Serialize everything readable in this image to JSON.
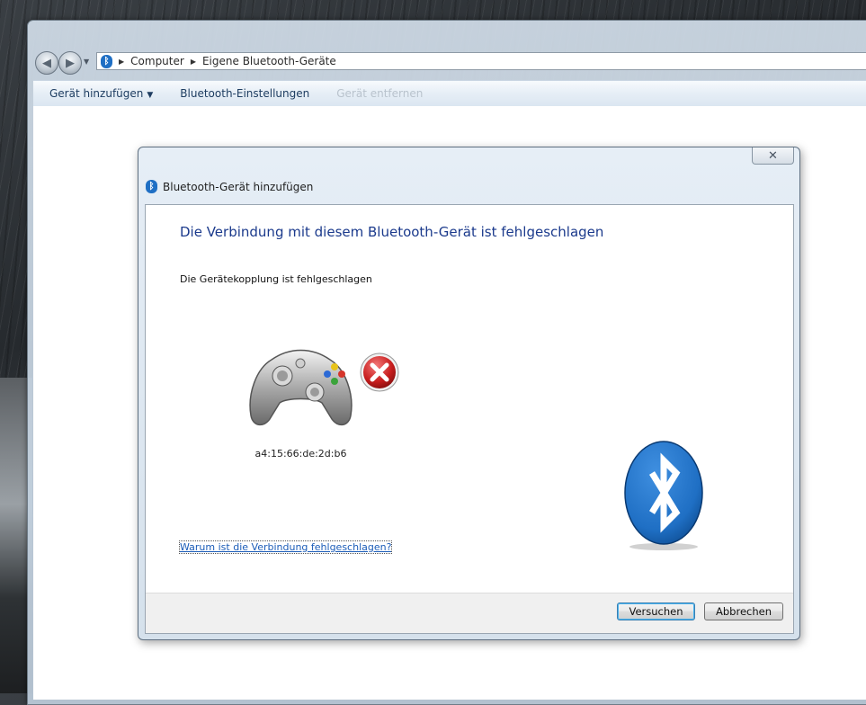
{
  "explorer": {
    "breadcrumb": [
      "Computer",
      "Eigene Bluetooth-Geräte"
    ],
    "toolbar": {
      "add_device": "Gerät hinzufügen",
      "bluetooth_settings": "Bluetooth-Einstellungen",
      "remove_device": "Gerät entfernen"
    }
  },
  "dialog": {
    "title": "Bluetooth-Gerät hinzufügen",
    "heading": "Die Verbindung mit diesem Bluetooth-Gerät ist fehlgeschlagen",
    "subtext": "Die Gerätekopplung ist fehlgeschlagen",
    "device_address": "a4:15:66:de:2d:b6",
    "help_link": "Warum ist die Verbindung fehlgeschlagen?",
    "buttons": {
      "retry": "Versuchen",
      "cancel": "Abbrechen"
    }
  },
  "colors": {
    "heading": "#1b3a8c",
    "link": "#1b5cb8",
    "bluetooth": "#1f6fc4",
    "error": "#c81e1e"
  },
  "icons": {
    "device": "gamepad-icon",
    "status": "error-x-icon",
    "brand": "bluetooth-icon"
  }
}
